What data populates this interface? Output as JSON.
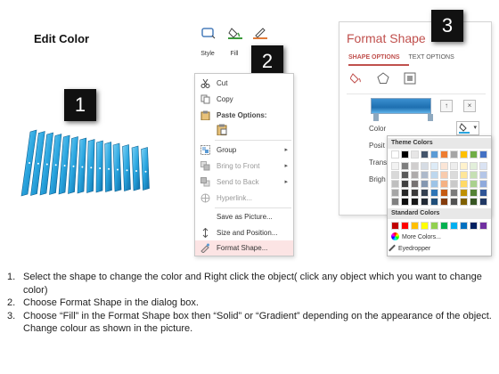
{
  "title": "Edit Color",
  "badges": [
    "1",
    "2",
    "3"
  ],
  "ribbon": {
    "items": [
      {
        "label": "Style",
        "icon": "shape-style-icon"
      },
      {
        "label": "Fill",
        "icon": "paint-bucket-icon"
      },
      {
        "label": "O",
        "icon": "pen-outline-icon"
      }
    ]
  },
  "context_menu": {
    "items": [
      {
        "label": "Cut",
        "icon": "scissors-icon",
        "disabled": false
      },
      {
        "label": "Copy",
        "icon": "copy-icon",
        "disabled": false
      },
      {
        "label": "Paste Options:",
        "icon": "clipboard-icon",
        "disabled": false
      },
      {
        "label": "Group",
        "icon": "group-icon",
        "disabled": false,
        "submenu": true
      },
      {
        "label": "Bring to Front",
        "icon": "bring-front-icon",
        "disabled": true,
        "submenu": true
      },
      {
        "label": "Send to Back",
        "icon": "send-back-icon",
        "disabled": true,
        "submenu": true
      },
      {
        "label": "Hyperlink...",
        "icon": "hyperlink-icon",
        "disabled": true
      },
      {
        "label": "Save as Picture...",
        "icon": "save-picture-icon",
        "disabled": false
      },
      {
        "label": "Size and Position...",
        "icon": "size-position-icon",
        "disabled": false
      },
      {
        "label": "Format Shape...",
        "icon": "format-shape-icon",
        "disabled": false,
        "highlighted": true
      }
    ]
  },
  "format_pane": {
    "title": "Format Shape",
    "tabs": [
      "SHAPE OPTIONS",
      "TEXT OPTIONS"
    ],
    "icons": [
      "fill-line-icon",
      "effects-pentagon-icon",
      "size-properties-icon"
    ],
    "props": [
      "Color",
      "Posit",
      "Trans",
      "Brigh"
    ],
    "accent": "#c0504d"
  },
  "color_popup": {
    "theme_label": "Theme Colors",
    "standard_label": "Standard Colors",
    "more_colors": "More Colors...",
    "eyedropper": "Eyedropper",
    "theme_top": [
      "#ffffff",
      "#000000",
      "#e7e6e6",
      "#44546a",
      "#5b9bd5",
      "#ed7d31",
      "#a5a5a5",
      "#ffc000",
      "#70ad47",
      "#4472c4"
    ],
    "theme_shades": [
      [
        "#f2f2f2",
        "#7f7f7f",
        "#d0cece",
        "#d6dce4",
        "#ddebf7",
        "#fbe5d6",
        "#ededed",
        "#fff2cc",
        "#e2efda",
        "#dae3f3"
      ],
      [
        "#d9d9d9",
        "#595959",
        "#aeabab",
        "#adb9ca",
        "#bdd7ee",
        "#f8cbad",
        "#dbdbdb",
        "#ffe699",
        "#c6e0b4",
        "#b4c6e7"
      ],
      [
        "#bfbfbf",
        "#404040",
        "#757171",
        "#8497b0",
        "#9dc3e6",
        "#f4b183",
        "#c9c9c9",
        "#ffd966",
        "#a9d08e",
        "#8faadc"
      ],
      [
        "#a6a6a6",
        "#262626",
        "#3a3838",
        "#333f50",
        "#2e75b6",
        "#c55a11",
        "#7b7b7b",
        "#bf9000",
        "#548235",
        "#2f5597"
      ],
      [
        "#808080",
        "#0d0d0d",
        "#161616",
        "#222a35",
        "#1f4e79",
        "#843c0c",
        "#525252",
        "#7f6000",
        "#375623",
        "#203864"
      ]
    ],
    "standard": [
      "#c00000",
      "#ff0000",
      "#ffc000",
      "#ffff00",
      "#92d050",
      "#00b050",
      "#00b0f0",
      "#0070c0",
      "#002060",
      "#7030a0"
    ]
  },
  "instructions": [
    {
      "num": "1.",
      "text": "Select the shape to change the color and Right click the object( click any object which you want to change color)"
    },
    {
      "num": "2.",
      "text": "Choose Format Shape in the dialog box."
    },
    {
      "num": "3.",
      "text": "Choose “Fill” in the Format Shape box then “Solid” or “Gradient” depending on the appearance of the object. Change colour as shown in the picture."
    }
  ]
}
